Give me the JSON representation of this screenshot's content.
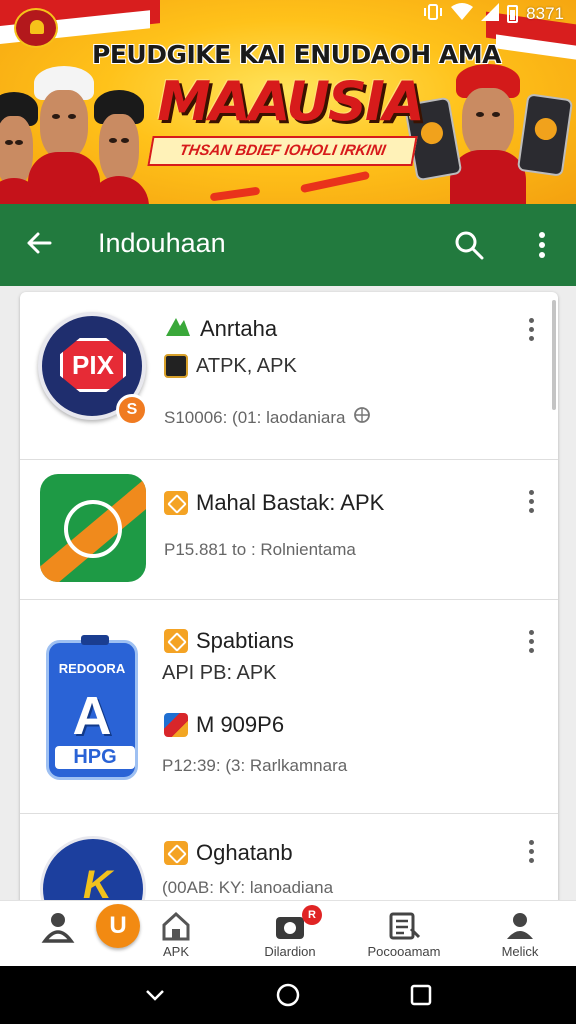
{
  "status_bar": {
    "time": "8371"
  },
  "banner": {
    "headline": "PEUDGIKE KAI ENUDAOH AMA",
    "big_word": "MAAUSIA",
    "tagline": "THSAN BDIEF IOHOLI IRKINI"
  },
  "app_bar": {
    "title": "Indouhaan"
  },
  "items": [
    {
      "title": "Anrtaha",
      "subtitle": "ATPK, APK",
      "meta": "S10006: (01: laodaniara",
      "icon_text": "PIX",
      "coin_text": "S"
    },
    {
      "title": "Mahal Bastak: APK",
      "meta": "P15.881 to : Rolnientama"
    },
    {
      "title": "Spabtians",
      "subtitle": "API PB: APK",
      "secondary": "M 909P6",
      "meta": "P12:39: (3: Rarlkamnara",
      "icon_top": "REDOORA",
      "icon_letter": "A",
      "icon_bottom": "HPG"
    },
    {
      "title": "Oghatanb",
      "meta": "(00AB: KY: lanoadiana",
      "icon_letter": "K"
    }
  ],
  "bottom_nav": {
    "fab_label": "U",
    "items": [
      {
        "label": ""
      },
      {
        "label": "APK"
      },
      {
        "label": "Dilardion",
        "badge": "R"
      },
      {
        "label": "Pocooamam"
      },
      {
        "label": "Melick"
      }
    ]
  },
  "colors": {
    "app_bar": "#227a3e",
    "accent": "#f28a12",
    "badge": "#e02424"
  }
}
